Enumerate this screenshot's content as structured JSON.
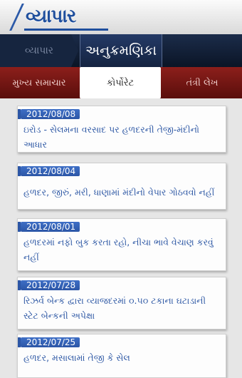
{
  "header": {
    "logo_text": "વ્યાપાર"
  },
  "nav": {
    "left_label": "વ્યાપાર",
    "center_label": "અનુક્રમણિકા"
  },
  "subnav": {
    "tabs": [
      {
        "label": "મુખ્ય સમાચાર"
      },
      {
        "label": "કોર્પોરેટ"
      },
      {
        "label": "તંત્રી લેખ"
      }
    ]
  },
  "articles": [
    {
      "date": "2012/08/08",
      "title": "ઇરોડ - સેલમના વરસાદ પર હળદરની તેજી-મંદીનો આધાર"
    },
    {
      "date": "2012/08/04",
      "title": "હળદર, જીરું, મરી, ધાણામાં મંદીનો વેપાર ગોઠવવો નહીં"
    },
    {
      "date": "2012/08/01",
      "title": "હળદરમાં નફો બુક કરતા રહો, નીચા ભાવે વેચાણ કરવું નહીં"
    },
    {
      "date": "2012/07/28",
      "title": "રિઝર્વ બેન્ક દ્વારા વ્યાજદરમાં ૦.૫૦ ટકાના ઘટાડાની સ્ટેટ બેન્કની અપેક્ષા"
    },
    {
      "date": "2012/07/25",
      "title": "હળદર, મસાલામાં તેજી કે સેલ"
    }
  ],
  "colors": {
    "accent": "#2a55a3",
    "nav_bg": "#0b1526",
    "subnav_bg": "#7a1915"
  }
}
